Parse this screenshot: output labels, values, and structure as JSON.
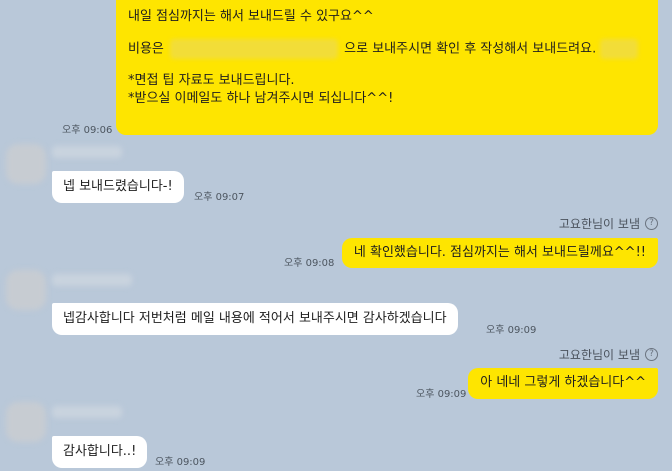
{
  "messages": {
    "m1": {
      "line1": "내일 점심까지는 해서 보내드릴 수 있구요^^",
      "line2_prefix": "비용은",
      "line2_middle": "으로 보내주시면 확인 후 작성해서 보내드려요.",
      "line3": "*면접 팁 자료도 보내드립니다.",
      "line4": "*받으실 이메일도 하나 남겨주시면 되십니다^^!",
      "time": "오후 09:06"
    },
    "m2": {
      "text": "넵 보내드렸습니다-!",
      "time": "오후 09:07"
    },
    "m3": {
      "sender": "고요한님이 보냄",
      "text": "네 확인했습니다. 점심까지는 해서 보내드릴께요^^!!",
      "time": "오후 09:08"
    },
    "m4": {
      "text": "넵감사합니다 저번처럼 메일 내용에 적어서 보내주시면 감사하겠습니다",
      "time": "오후 09:09"
    },
    "m5": {
      "sender": "고요한님이 보냄",
      "text": "아 네네 그렇게 하겠습니다^^",
      "time": "오후 09:09"
    },
    "m6": {
      "text": "감사합니다..!",
      "time": "오후 09:09"
    }
  },
  "help_mark": "?",
  "colors": {
    "background": "#b9c8d9",
    "my_bubble": "#fee500",
    "other_bubble": "#ffffff"
  }
}
